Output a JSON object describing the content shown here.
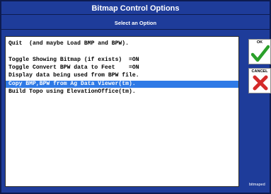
{
  "window": {
    "title": "Bitmap Control Options",
    "subtitle": "Select an Option"
  },
  "list": {
    "items": [
      "Quit  (and maybe Load BMP and BPW).",
      "",
      "Toggle Showing Bitmap (if exists)  =ON",
      "Toggle Convert BPW data to Feet    =ON",
      "Display data being used from BPW file.",
      "Copy BMP,BPW from Ag Data Viewer(tm).",
      "Build Topo using ElevationOffice(tm)."
    ],
    "selected_index": 5
  },
  "buttons": {
    "ok_label": "OK",
    "cancel_label": "CANCEL"
  },
  "footer": "bitmaped",
  "colors": {
    "background": "#1e3c9a",
    "selection": "#2f7ae6",
    "ok_icon": "#2aa02a",
    "cancel_icon": "#d42a2a"
  }
}
